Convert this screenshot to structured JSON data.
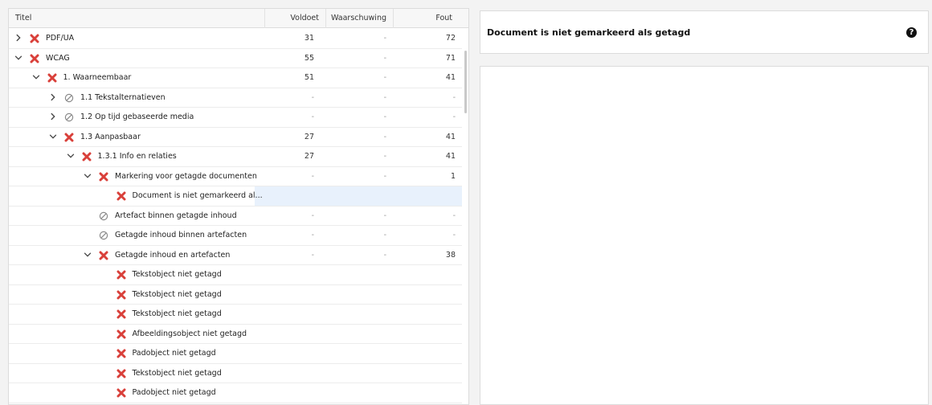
{
  "columns": {
    "title": "Titel",
    "voldoet": "Voldoet",
    "waarschuwing": "Waarschuwing",
    "fout": "Fout"
  },
  "rows": [
    {
      "label": "PDF/UA",
      "level": 0,
      "chevron": "right",
      "status": "fail",
      "voldoet": "31",
      "waarschuwing": "-",
      "fout": "72"
    },
    {
      "label": "WCAG",
      "level": 0,
      "chevron": "down",
      "status": "fail",
      "voldoet": "55",
      "waarschuwing": "-",
      "fout": "71"
    },
    {
      "label": "1. Waarneembaar",
      "level": 1,
      "chevron": "down",
      "status": "fail",
      "voldoet": "51",
      "waarschuwing": "-",
      "fout": "41"
    },
    {
      "label": "1.1 Tekstalternatieven",
      "level": 2,
      "chevron": "right",
      "status": "na",
      "voldoet": "-",
      "waarschuwing": "-",
      "fout": "-"
    },
    {
      "label": "1.2 Op tijd gebaseerde media",
      "level": 2,
      "chevron": "right",
      "status": "na",
      "voldoet": "-",
      "waarschuwing": "-",
      "fout": "-"
    },
    {
      "label": "1.3 Aanpasbaar",
      "level": 2,
      "chevron": "down",
      "status": "fail",
      "voldoet": "27",
      "waarschuwing": "-",
      "fout": "41"
    },
    {
      "label": "1.3.1 Info en relaties",
      "level": 3,
      "chevron": "down",
      "status": "fail",
      "voldoet": "27",
      "waarschuwing": "-",
      "fout": "41"
    },
    {
      "label": "Markering voor getagde documenten",
      "level": 4,
      "chevron": "down",
      "status": "fail",
      "voldoet": "-",
      "waarschuwing": "-",
      "fout": "1"
    },
    {
      "label": "Document is niet gemarkeerd al...",
      "level": 5,
      "chevron": "none",
      "status": "fail",
      "voldoet": "",
      "waarschuwing": "",
      "fout": "",
      "selected": true
    },
    {
      "label": "Artefact binnen getagde inhoud",
      "level": 4,
      "chevron": "none",
      "status": "na",
      "voldoet": "-",
      "waarschuwing": "-",
      "fout": "-"
    },
    {
      "label": "Getagde inhoud binnen artefacten",
      "level": 4,
      "chevron": "none",
      "status": "na",
      "voldoet": "-",
      "waarschuwing": "-",
      "fout": "-"
    },
    {
      "label": "Getagde inhoud en artefacten",
      "level": 4,
      "chevron": "down",
      "status": "fail",
      "voldoet": "-",
      "waarschuwing": "-",
      "fout": "38"
    },
    {
      "label": "Tekstobject niet getagd",
      "level": 5,
      "chevron": "none",
      "status": "fail",
      "voldoet": "",
      "waarschuwing": "",
      "fout": ""
    },
    {
      "label": "Tekstobject niet getagd",
      "level": 5,
      "chevron": "none",
      "status": "fail",
      "voldoet": "",
      "waarschuwing": "",
      "fout": ""
    },
    {
      "label": "Tekstobject niet getagd",
      "level": 5,
      "chevron": "none",
      "status": "fail",
      "voldoet": "",
      "waarschuwing": "",
      "fout": ""
    },
    {
      "label": "Afbeeldingsobject niet getagd",
      "level": 5,
      "chevron": "none",
      "status": "fail",
      "voldoet": "",
      "waarschuwing": "",
      "fout": ""
    },
    {
      "label": "Padobject niet getagd",
      "level": 5,
      "chevron": "none",
      "status": "fail",
      "voldoet": "",
      "waarschuwing": "",
      "fout": ""
    },
    {
      "label": "Tekstobject niet getagd",
      "level": 5,
      "chevron": "none",
      "status": "fail",
      "voldoet": "",
      "waarschuwing": "",
      "fout": ""
    },
    {
      "label": "Padobject niet getagd",
      "level": 5,
      "chevron": "none",
      "status": "fail",
      "voldoet": "",
      "waarschuwing": "",
      "fout": ""
    }
  ],
  "detail": {
    "title": "Document is niet gemarkeerd als getagd",
    "help_glyph": "?"
  },
  "colors": {
    "fail": "#d9403a",
    "na": "#8a8a8a",
    "selected_row": "#e8f1fc"
  }
}
